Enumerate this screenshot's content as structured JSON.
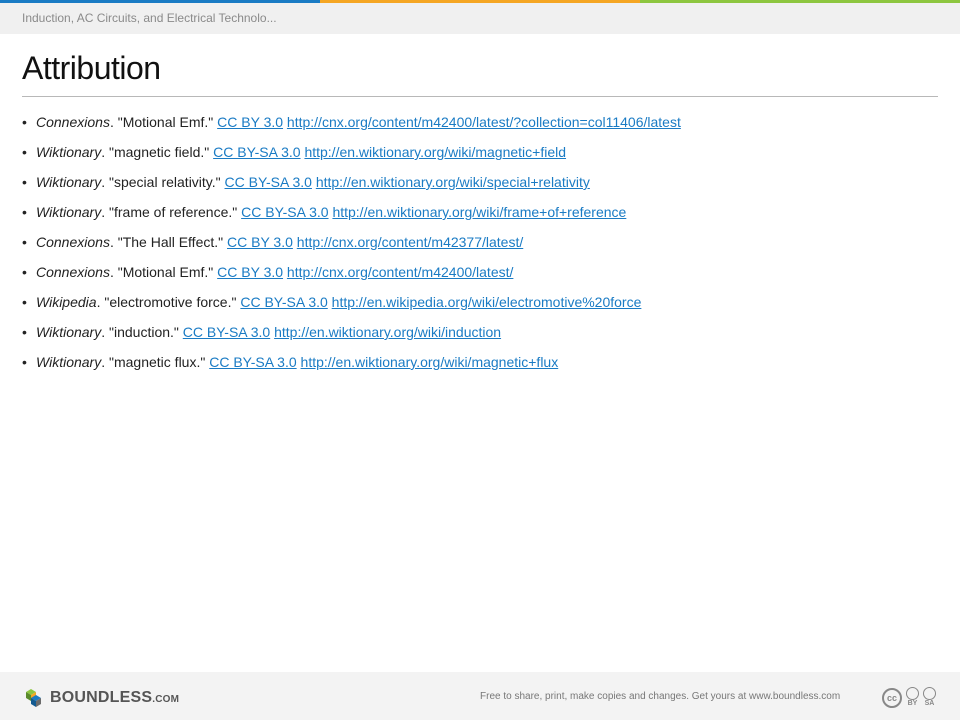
{
  "header": {
    "breadcrumb": "Induction, AC Circuits, and Electrical Technolo..."
  },
  "colors": {
    "topbar": [
      "#1a7bc4",
      "#f5a623",
      "#8dc63f"
    ],
    "link": "#1a7bc4"
  },
  "page": {
    "title": "Attribution"
  },
  "references": [
    {
      "source": "Connexions",
      "title": "\"Motional Emf.\"",
      "license": "CC BY 3.0",
      "url": "http://cnx.org/content/m42400/latest/?collection=col11406/latest"
    },
    {
      "source": "Wiktionary",
      "title": "\"magnetic field.\"",
      "license": "CC BY-SA 3.0",
      "url": "http://en.wiktionary.org/wiki/magnetic+field"
    },
    {
      "source": "Wiktionary",
      "title": "\"special relativity.\"",
      "license": "CC BY-SA 3.0",
      "url": "http://en.wiktionary.org/wiki/special+relativity"
    },
    {
      "source": "Wiktionary",
      "title": "\"frame of reference.\"",
      "license": "CC BY-SA 3.0",
      "url": "http://en.wiktionary.org/wiki/frame+of+reference"
    },
    {
      "source": "Connexions",
      "title": "\"The Hall Effect.\"",
      "license": "CC BY 3.0",
      "url": "http://cnx.org/content/m42377/latest/"
    },
    {
      "source": "Connexions",
      "title": "\"Motional Emf.\"",
      "license": "CC BY 3.0",
      "url": "http://cnx.org/content/m42400/latest/"
    },
    {
      "source": "Wikipedia",
      "title": "\"electromotive force.\"",
      "license": "CC BY-SA 3.0",
      "url": "http://en.wikipedia.org/wiki/electromotive%20force"
    },
    {
      "source": "Wiktionary",
      "title": "\"induction.\"",
      "license": "CC BY-SA 3.0",
      "url": "http://en.wiktionary.org/wiki/induction"
    },
    {
      "source": "Wiktionary",
      "title": "\"magnetic flux.\"",
      "license": "CC BY-SA 3.0",
      "url": "http://en.wiktionary.org/wiki/magnetic+flux"
    }
  ],
  "footer": {
    "logo_main": "BOUNDLESS",
    "logo_suffix": ".COM",
    "note": "Free to share, print, make copies and changes. Get yours at www.boundless.com",
    "cc_badge": "cc",
    "cc_by": "BY",
    "cc_sa": "SA",
    "logo_icon": "cube-cluster-icon"
  }
}
